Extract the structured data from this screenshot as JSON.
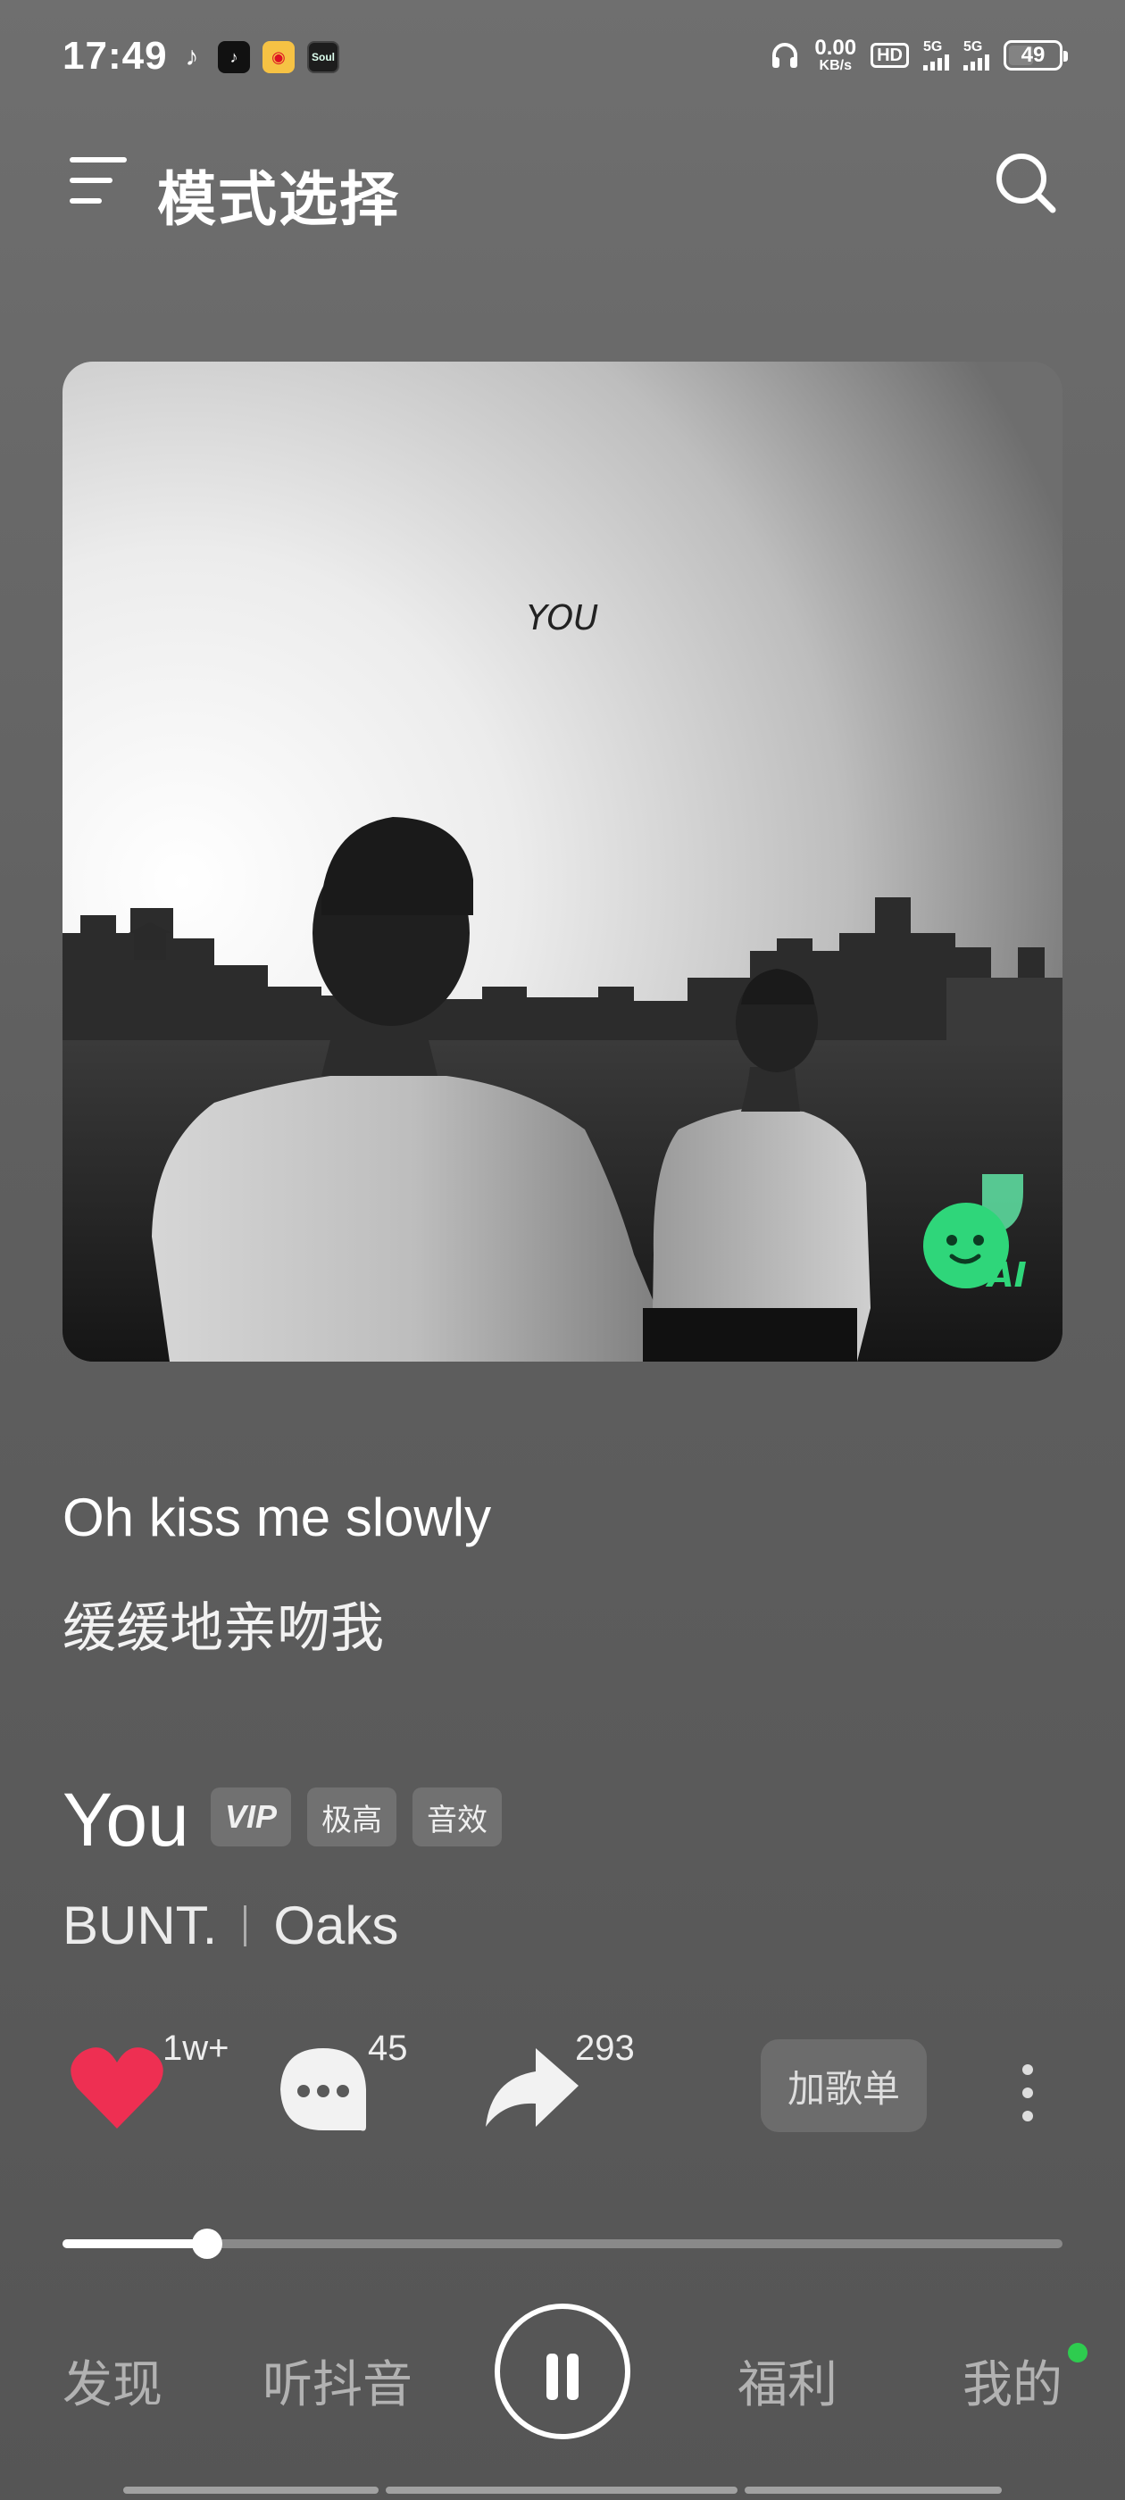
{
  "status_bar": {
    "time": "17:49",
    "app_icons": [
      "music-note-icon",
      "douyin-icon",
      "weibo-icon",
      "soul-icon"
    ],
    "soul_label": "Soul",
    "net_speed_value": "0.00",
    "net_speed_unit": "KB/s",
    "hd_label": "HD",
    "sim1_label": "5G",
    "sim2_label": "5G",
    "battery": "49"
  },
  "header": {
    "title": "模式选择"
  },
  "album": {
    "cover_text": "YOU",
    "ai_badge_label": "AI"
  },
  "lyrics": {
    "line_en": "Oh kiss me slowly",
    "line_cn": "缓缓地亲吻我"
  },
  "song": {
    "title": "You",
    "tags": [
      "VIP",
      "极高",
      "音效"
    ],
    "artists": [
      "BUNT.",
      "Oaks"
    ]
  },
  "actions": {
    "like_count": "1w+",
    "comment_count": "45",
    "share_count": "293",
    "add_playlist_label": "加歌单"
  },
  "playback": {
    "progress": 0.145,
    "state": "playing"
  },
  "bottom_nav": {
    "items": [
      "发现",
      "听抖音",
      "福利",
      "我的"
    ]
  },
  "colors": {
    "like": "#ee2f52",
    "ai_badge": "#2fd67a",
    "nav_dot": "#2ecc4f"
  }
}
